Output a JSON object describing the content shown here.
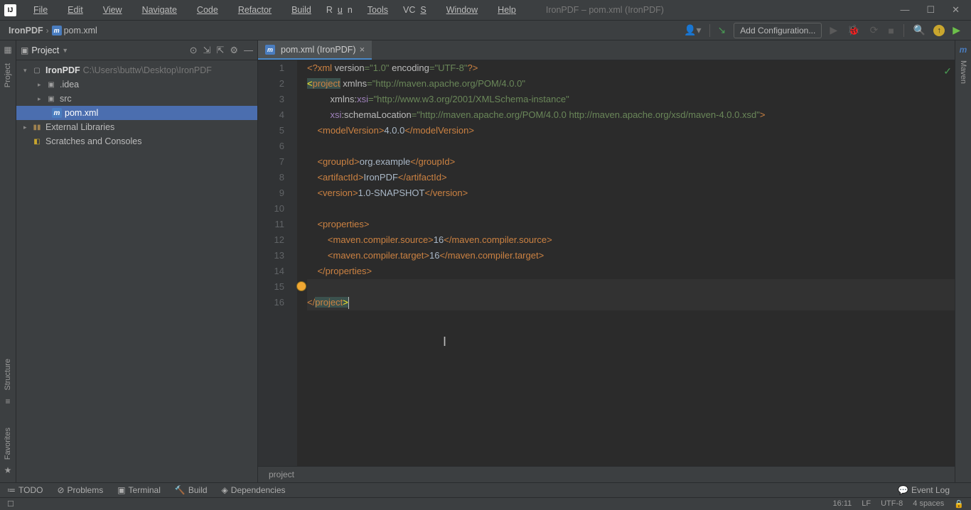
{
  "menu": {
    "file": "File",
    "edit": "Edit",
    "view": "View",
    "navigate": "Navigate",
    "code": "Code",
    "refactor": "Refactor",
    "build": "Build",
    "run": "Run",
    "tools": "Tools",
    "vcs": "VCS",
    "window": "Window",
    "help": "Help"
  },
  "window_title": "IronPDF – pom.xml (IronPDF)",
  "breadcrumb": {
    "root": "IronPDF",
    "file": "pom.xml"
  },
  "toolbar": {
    "add_config": "Add Configuration..."
  },
  "project_tool": {
    "title": "Project",
    "root": {
      "name": "IronPDF",
      "path": "C:\\Users\\buttw\\Desktop\\IronPDF"
    },
    "children": [
      {
        "name": ".idea",
        "type": "folder"
      },
      {
        "name": "src",
        "type": "folder"
      },
      {
        "name": "pom.xml",
        "type": "pom",
        "selected": true
      }
    ],
    "external_libs": "External Libraries",
    "scratches": "Scratches and Consoles"
  },
  "left_tools": {
    "project": "Project",
    "structure": "Structure",
    "favorites": "Favorites"
  },
  "right_tools": {
    "maven": "Maven"
  },
  "editor": {
    "tab_label": "pom.xml (IronPDF)",
    "breadcrumb_path": "project",
    "lines": [
      1,
      2,
      3,
      4,
      5,
      6,
      7,
      8,
      9,
      10,
      11,
      12,
      13,
      14,
      15,
      16
    ],
    "xml": {
      "l1a": "<?xml ",
      "l1_v": "version",
      "l1_vv": "\"1.0\"",
      "l1_e": " encoding",
      "l1_ev": "\"UTF-8\"",
      "l1b": "?>",
      "proj_open": "project",
      "xmlns": " xmlns",
      "xmlns_v": "\"http://maven.apache.org/POM/4.0.0\"",
      "xsi_ns": "xmlns:",
      "xsi": "xsi",
      "xsi_v": "\"http://www.w3.org/2001/XMLSchema-instance\"",
      "sl_ns": "xsi",
      "sl_attr": ":schemaLocation",
      "sl_v": "\"http://maven.apache.org/POM/4.0.0 http://maven.apache.org/xsd/maven-4.0.0.xsd\"",
      "mv_o": "modelVersion",
      "mv_t": "4.0.0",
      "gid_o": "groupId",
      "gid_t": "org.example",
      "aid_o": "artifactId",
      "aid_t": "IronPDF",
      "ver_o": "version",
      "ver_t": "1.0-SNAPSHOT",
      "props_o": "properties",
      "mcs_o": "maven.compiler.source",
      "mcs_t": "16",
      "mct_o": "maven.compiler.target",
      "mct_t": "16"
    }
  },
  "bottom": {
    "todo": "TODO",
    "problems": "Problems",
    "terminal": "Terminal",
    "build": "Build",
    "deps": "Dependencies",
    "eventlog": "Event Log"
  },
  "status": {
    "line_col": "16:11",
    "lineend": "LF",
    "encoding": "UTF-8",
    "indent": "4 spaces"
  }
}
